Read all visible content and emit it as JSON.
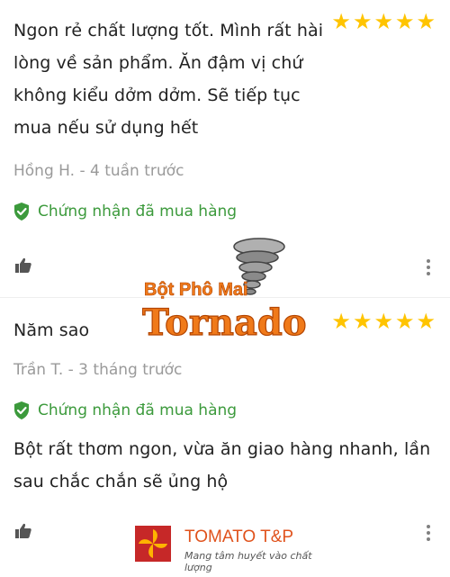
{
  "reviews": [
    {
      "body": "Ngon rẻ chất lượng tốt. Mình rất hài lòng về sản phẩm. Ăn đậm vị chứ không kiểu dởm dởm. Sẽ tiếp tục mua nếu sử dụng hết",
      "rating": 5,
      "author_time": "Hồng H. - 4 tuần trước",
      "verified_label": "Chứng nhận đã mua hàng"
    },
    {
      "title": "Năm sao",
      "rating": 5,
      "author_time": "Trần T. - 3 tháng trước",
      "verified_label": "Chứng nhận đã mua hàng",
      "body": "Bột rất thơm ngon, vừa ăn giao hàng nhanh, lần sau chắc chắn sẽ ủng hộ"
    }
  ],
  "watermark": {
    "product_line": "Bột Phô Mai",
    "product_name": "Tornado",
    "brand_name": "TOMATO T&P",
    "brand_slogan": "Mang tâm huyết vào chất lượng"
  },
  "colors": {
    "star": "#ffc400",
    "verified": "#3c9a3c",
    "meta": "#9a9a9a",
    "text": "#222222",
    "brand_orange": "#f07a1a"
  }
}
